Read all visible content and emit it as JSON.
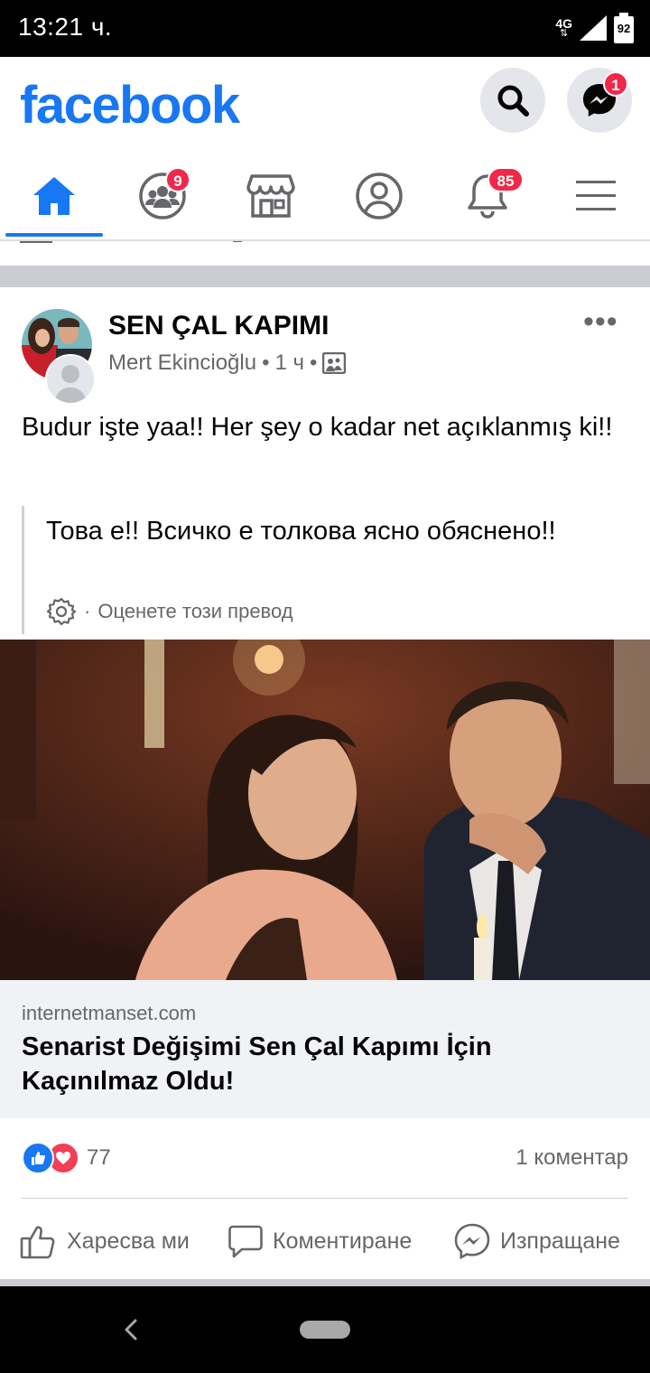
{
  "status_bar": {
    "time": "13:21 ч.",
    "network": "4G",
    "battery": "92"
  },
  "header": {
    "logo": "facebook",
    "messenger_badge": "1"
  },
  "nav": {
    "tabs": [
      {
        "name": "home",
        "icon": "home-icon",
        "active": true
      },
      {
        "name": "groups",
        "icon": "groups-icon",
        "badge": "9"
      },
      {
        "name": "marketplace",
        "icon": "marketplace-icon"
      },
      {
        "name": "profile",
        "icon": "profile-icon"
      },
      {
        "name": "notifications",
        "icon": "bell-icon",
        "badge": "85"
      },
      {
        "name": "menu",
        "icon": "menu-icon"
      }
    ]
  },
  "post": {
    "page_name": "SEN ÇAL KAPIMI",
    "author": "Mert Ekincioğlu",
    "separator": "•",
    "time": "1 ч",
    "text": "Budur işte yaa!! Her şey o kadar net açıklanmış ki!!",
    "translation": {
      "text": "Това е!! Всичко е толкова ясно обяснено!!",
      "rate_label": "Оценете този превод"
    },
    "link": {
      "domain": "internetmanset.com",
      "title": "Senarist Değişimi Sen Çal Kapımı İçin Kaçınılmaz Oldu!"
    },
    "reactions": {
      "count": "77",
      "comments": "1 коментар"
    },
    "actions": {
      "like": "Харесва ми",
      "comment": "Коментиране",
      "share": "Изпращане"
    }
  },
  "colors": {
    "brand": "#1877f2",
    "badge": "#f02849",
    "secondary_text": "#65676b"
  }
}
